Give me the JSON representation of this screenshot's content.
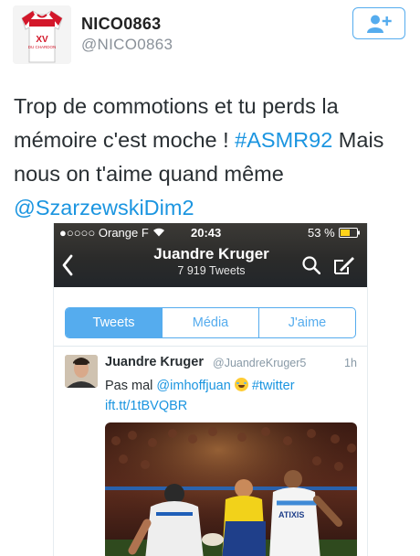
{
  "tweet": {
    "author_name": "NICO0863",
    "author_handle": "@NICO0863",
    "avatar_jersey": {
      "label": "XV",
      "sublabel": "DU CHARDON"
    },
    "text_before": "Trop de commotions et tu perds la mémoire c'est moche ! ",
    "hashtag": "#ASMR92",
    "text_after": " Mais nous on t'aime quand même ",
    "mention": "@SzarzewskiDim2",
    "follow_icon": "add-user-icon"
  },
  "embedded_screenshot": {
    "status_bar": {
      "carrier": "●○○○○ Orange F",
      "time": "20:43",
      "battery": "53 %"
    },
    "profile": {
      "name": "Juandre Kruger",
      "tweet_count": "7 919 Tweets"
    },
    "tabs": [
      {
        "label": "Tweets",
        "active": true
      },
      {
        "label": "Média",
        "active": false
      },
      {
        "label": "J'aime",
        "active": false
      }
    ],
    "inner_tweet": {
      "name": "Juandre Kruger",
      "handle": "@JuandreKruger5",
      "time": "1h",
      "text_start": "Pas mal ",
      "mention": "@imhoffjuan",
      "hashtag": "#twitter",
      "link": "ift.tt/1tBVQBR"
    },
    "photo_jersey_text": "ATIXIS"
  },
  "colors": {
    "accent": "#55acee",
    "link": "#1b95e0",
    "text": "#292f33",
    "muted": "#8899a6"
  }
}
